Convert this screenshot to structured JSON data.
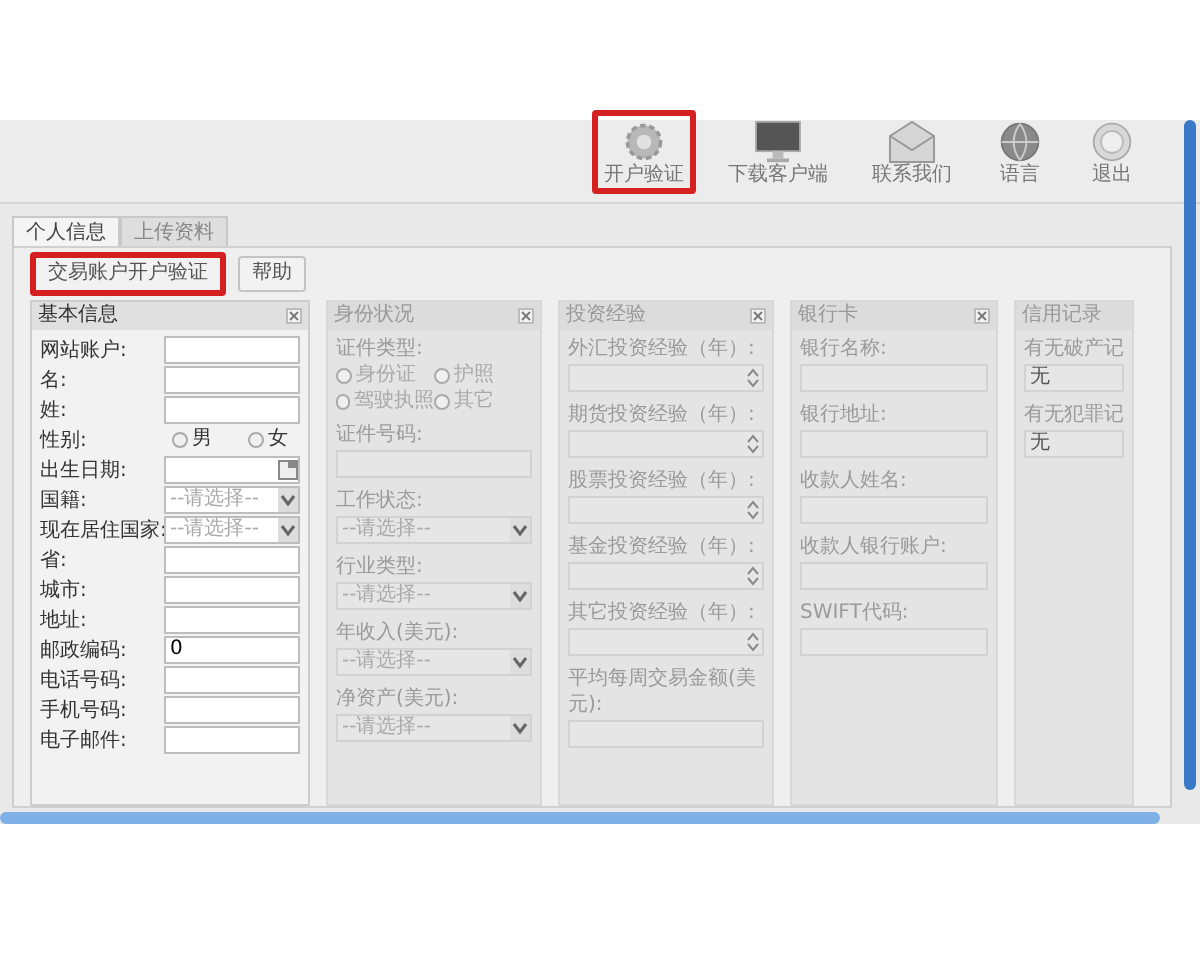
{
  "toolbar": [
    {
      "label": "开户验证",
      "highlighted": true
    },
    {
      "label": "下载客户端",
      "highlighted": false
    },
    {
      "label": "联系我们",
      "highlighted": false
    },
    {
      "label": "语言",
      "highlighted": false
    },
    {
      "label": "退出",
      "highlighted": false
    }
  ],
  "tabs": [
    {
      "label": "个人信息",
      "selected": true
    },
    {
      "label": "上传资料",
      "selected": false
    }
  ],
  "buttons": [
    {
      "label": "交易账户开户验证",
      "highlighted": true
    },
    {
      "label": "帮助",
      "highlighted": false
    }
  ],
  "panels": [
    {
      "title": "基本信息",
      "kind": "inline",
      "disabled": false,
      "closable": true,
      "fields": [
        {
          "label": "网站账户:",
          "kind": "text"
        },
        {
          "label": "名:",
          "kind": "text"
        },
        {
          "label": "姓:",
          "kind": "text"
        },
        {
          "label": "性别:",
          "kind": "radio",
          "options": [
            {
              "label": "男",
              "selected": false
            },
            {
              "label": "女",
              "selected": false
            }
          ]
        },
        {
          "label": "出生日期:",
          "kind": "date"
        },
        {
          "label": "国籍:",
          "kind": "select",
          "value": "--请选择--"
        },
        {
          "label": "现在居住国家:",
          "kind": "select",
          "value": "--请选择--"
        },
        {
          "label": "省:",
          "kind": "text"
        },
        {
          "label": "城市:",
          "kind": "text"
        },
        {
          "label": "地址:",
          "kind": "text"
        },
        {
          "label": "邮政编码:",
          "kind": "text",
          "value": "0"
        },
        {
          "label": "电话号码:",
          "kind": "text"
        },
        {
          "label": "手机号码:",
          "kind": "text"
        },
        {
          "label": "电子邮件:",
          "kind": "text"
        }
      ]
    },
    {
      "title": "身份状况",
      "kind": "stacked",
      "disabled": true,
      "closable": true,
      "fields": [
        {
          "label": "证件类型:",
          "kind": "radio",
          "options": [
            {
              "label": "身份证",
              "selected": false
            },
            {
              "label": "护照",
              "selected": false
            },
            {
              "label": "驾驶执照",
              "selected": false
            },
            {
              "label": "其它",
              "selected": false
            }
          ]
        },
        {
          "label": "证件号码:",
          "kind": "text"
        },
        {
          "label": "工作状态:",
          "kind": "select",
          "value": "--请选择--"
        },
        {
          "label": "行业类型:",
          "kind": "select",
          "value": "--请选择--"
        },
        {
          "label": "年收入(美元):",
          "kind": "select",
          "value": "--请选择--"
        },
        {
          "label": "净资产(美元):",
          "kind": "select",
          "value": "--请选择--"
        }
      ]
    },
    {
      "title": "投资经验",
      "kind": "stacked",
      "disabled": true,
      "closable": true,
      "fields": [
        {
          "label": "外汇投资经验（年）:",
          "kind": "number"
        },
        {
          "label": "期货投资经验（年）:",
          "kind": "number"
        },
        {
          "label": "股票投资经验（年）:",
          "kind": "number"
        },
        {
          "label": "基金投资经验（年）:",
          "kind": "number"
        },
        {
          "label": "其它投资经验（年）:",
          "kind": "number"
        },
        {
          "label": "平均每周交易金额(美元):",
          "kind": "text"
        }
      ]
    },
    {
      "title": "银行卡",
      "kind": "stacked",
      "disabled": true,
      "closable": true,
      "fields": [
        {
          "label": "银行名称:",
          "kind": "text"
        },
        {
          "label": "银行地址:",
          "kind": "text"
        },
        {
          "label": "收款人姓名:",
          "kind": "text"
        },
        {
          "label": "收款人银行账户:",
          "kind": "text"
        },
        {
          "label": "SWIFT代码:",
          "kind": "text"
        }
      ]
    },
    {
      "title": "信用记录",
      "kind": "stacked",
      "disabled": true,
      "closable": false,
      "fields": [
        {
          "label": "有无破产记",
          "kind": "text",
          "value": "无"
        },
        {
          "label": "有无犯罪记",
          "kind": "text",
          "value": "无"
        }
      ]
    }
  ]
}
